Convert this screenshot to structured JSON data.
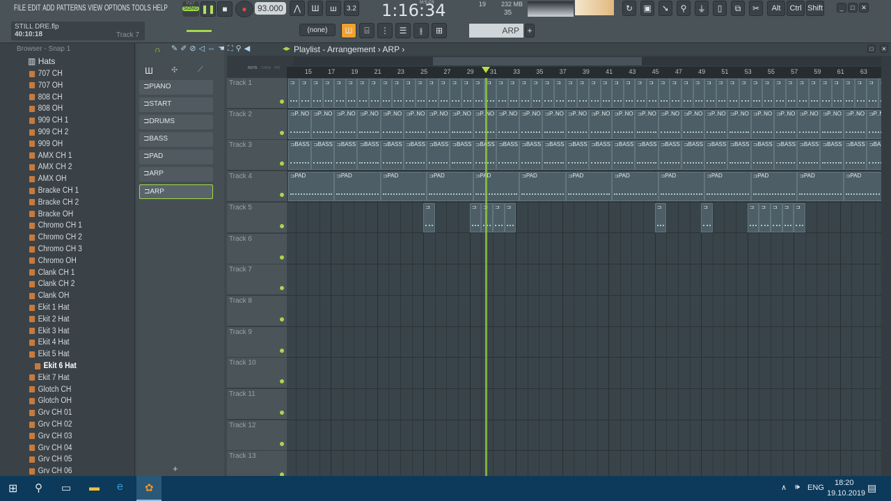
{
  "menu": [
    "FILE",
    "EDIT",
    "ADD",
    "PATTERNS",
    "VIEW",
    "OPTIONS",
    "TOOLS",
    "HELP"
  ],
  "project": {
    "file": "STILL DRE.flp",
    "time": "40:10:18",
    "hint": "Track 7"
  },
  "transport": {
    "mode_pat": "PAT",
    "mode_song": "SONG",
    "tempo": "93.000",
    "clock": "1:16:34",
    "clock_unit": "M:S:CS",
    "cpu": "19",
    "memory": "232 MB",
    "polyphony": "35"
  },
  "snap": "(none)",
  "current_pattern": "ARP",
  "toolbar_right": [
    "Alt",
    "Ctrl",
    "Shift"
  ],
  "browser": {
    "title": "Browser - Snap 1",
    "folder": "Hats",
    "selected": "Ekit 6 Hat",
    "items": [
      "707 CH",
      "707 OH",
      "808 CH",
      "808 OH",
      "909 CH 1",
      "909 CH 2",
      "909 OH",
      "AMX CH 1",
      "AMX CH 2",
      "AMX OH",
      "Bracke CH 1",
      "Bracke CH 2",
      "Bracke OH",
      "Chromo CH 1",
      "Chromo CH 2",
      "Chromo CH 3",
      "Chromo OH",
      "Clank CH 1",
      "Clank CH 2",
      "Clank OH",
      "Ekit 1 Hat",
      "Ekit 2 Hat",
      "Ekit 3 Hat",
      "Ekit 4 Hat",
      "Ekit 5 Hat",
      "Ekit 6 Hat",
      "Ekit 7 Hat",
      "Glotch CH",
      "Glotch OH",
      "Grv CH 01",
      "Grv CH 02",
      "Grv CH 03",
      "Grv CH 04",
      "Grv CH 05",
      "Grv CH 06"
    ]
  },
  "patterns": [
    "PIANO",
    "START",
    "DRUMS",
    "BASS",
    "PAD",
    "ARP",
    "ARP"
  ],
  "playlist": {
    "title": "Playlist - Arrangement",
    "crumb": "ARP",
    "tabs": [
      "NOTE",
      "CHAN",
      "PAT"
    ],
    "ruler": [
      15,
      17,
      19,
      21,
      23,
      25,
      27,
      29,
      31,
      33,
      35,
      37,
      39,
      41,
      43,
      45,
      47,
      49,
      51,
      53,
      55,
      57,
      59,
      61,
      63
    ],
    "playhead_bar": 30.4,
    "tracks": [
      "Track 1",
      "Track 2",
      "Track 3",
      "Track 4",
      "Track 5",
      "Track 6",
      "Track 7",
      "Track 8",
      "Track 9",
      "Track 10",
      "Track 11",
      "Track 12",
      "Track 13"
    ],
    "clips": [
      {
        "track": 0,
        "label": "",
        "start": 13.3,
        "len": 1,
        "every": 1,
        "count": 52
      },
      {
        "track": 1,
        "label": "P..NO",
        "start": 13.3,
        "len": 2,
        "every": 2,
        "count": 26
      },
      {
        "track": 2,
        "label": "BASS",
        "start": 13.3,
        "len": 2,
        "every": 2,
        "count": 26
      },
      {
        "track": 3,
        "label": "PAD",
        "start": 13.3,
        "len": 4,
        "every": 4,
        "count": 13
      },
      {
        "track": 4,
        "label": "",
        "bars": [
          25,
          29,
          30,
          31,
          32,
          45,
          49,
          53,
          54,
          55,
          56,
          57
        ],
        "len": 1
      }
    ]
  },
  "taskbar": {
    "lang": "ENG",
    "time": "18:20",
    "date": "19.10.2019"
  }
}
